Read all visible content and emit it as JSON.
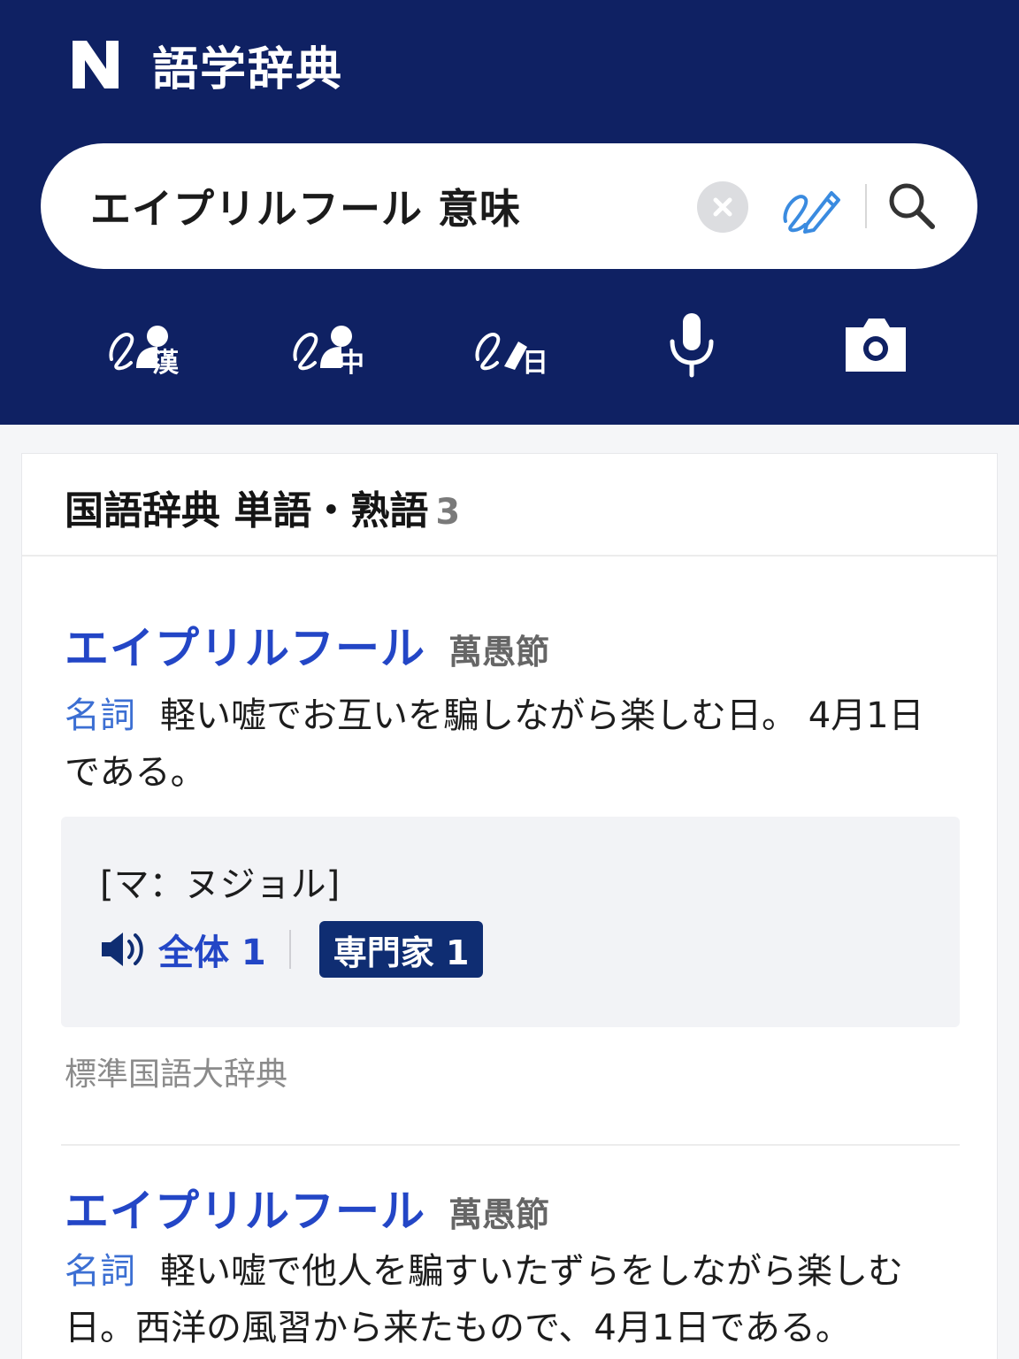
{
  "app": {
    "logo_letter": "N",
    "title": "語学辞典"
  },
  "search": {
    "query": "エイプリルフール 意味"
  },
  "icons": {
    "clear": "clear-icon",
    "handwriting": "handwriting-pen-icon",
    "search": "search-icon",
    "tool_kanji": "handwriting-kanji-icon",
    "tool_chinese": "handwriting-chinese-icon",
    "tool_japanese": "handwriting-japanese-icon",
    "tool_voice": "microphone-icon",
    "tool_camera": "camera-icon",
    "speaker": "speaker-icon"
  },
  "tools": {
    "kanji": "漢",
    "chinese": "中",
    "japanese": "日"
  },
  "colors": {
    "header_bg": "#0f2163",
    "link_blue": "#2346c6",
    "pos_blue": "#3c6fd3",
    "badge_bg": "#0f2d72"
  },
  "section": {
    "title": "国語辞典 単語・熟語",
    "count": "3"
  },
  "entries": [
    {
      "word": "エイプリルフール",
      "kanji": "萬愚節",
      "pos": "名詞",
      "definition": "軽い嘘でお互いを騙しながら楽しむ日。 4月1日である。",
      "pronunciation": "[マ：ヌジョル]",
      "all_label": "全体 1",
      "expert_label": "専門家 1",
      "source": "標準国語大辞典"
    },
    {
      "word": "エイプリルフール",
      "kanji": "萬愚節",
      "pos": "名詞",
      "definition": "軽い嘘で他人を騙すいたずらをしながら楽しむ日。西洋の風習から来たもので、4月1日である。"
    }
  ]
}
